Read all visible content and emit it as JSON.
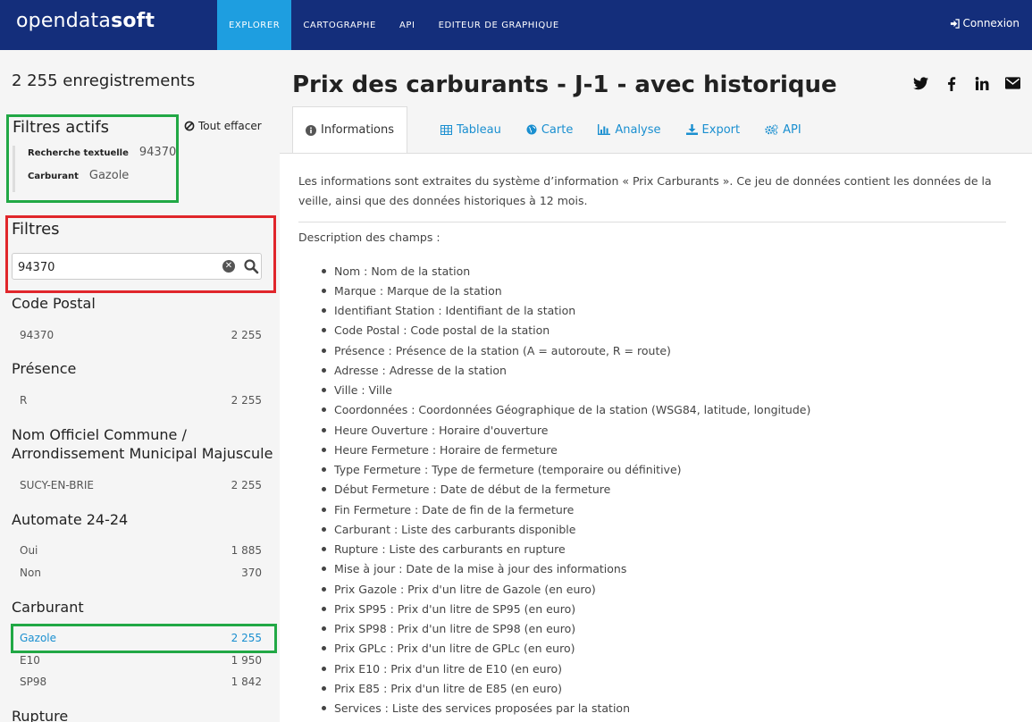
{
  "header": {
    "logo_light": "opendata",
    "logo_bold": "soft",
    "nav": [
      "EXPLORER",
      "CARTOGRAPHE",
      "API",
      "EDITEUR DE GRAPHIQUE"
    ],
    "login": "Connexion"
  },
  "sidebar": {
    "record_count": "2 255 enregistrements",
    "active_filters_title": "Filtres actifs",
    "clear_all": "Tout effacer",
    "active_filters": [
      {
        "label": "Recherche textuelle",
        "value": "94370"
      },
      {
        "label": "Carburant",
        "value": "Gazole"
      }
    ],
    "filters_title": "Filtres",
    "search_value": "94370",
    "facets": {
      "code_postal": {
        "title": "Code Postal",
        "items": [
          {
            "label": "94370",
            "count": "2 255"
          }
        ]
      },
      "presence": {
        "title": "Présence",
        "items": [
          {
            "label": "R",
            "count": "2 255"
          }
        ]
      },
      "commune": {
        "title_line1": "Nom Officiel Commune /",
        "title_line2": "Arrondissement Municipal Majuscule",
        "items": [
          {
            "label": "SUCY-EN-BRIE",
            "count": "2 255"
          }
        ]
      },
      "automate": {
        "title": "Automate 24-24",
        "items": [
          {
            "label": "Oui",
            "count": "1 885"
          },
          {
            "label": "Non",
            "count": "370"
          }
        ]
      },
      "carburant": {
        "title": "Carburant",
        "items": [
          {
            "label": "Gazole",
            "count": "2 255"
          },
          {
            "label": "E10",
            "count": "1 950"
          },
          {
            "label": "SP98",
            "count": "1 842"
          }
        ]
      },
      "rupture": {
        "title": "Rupture"
      }
    }
  },
  "main": {
    "title": "Prix des carburants - J-1 - avec historique",
    "tabs": [
      "Informations",
      "Tableau",
      "Carte",
      "Analyse",
      "Export",
      "API"
    ],
    "intro": "Les informations sont extraites du système d’information « Prix Carburants ». Ce jeu de données contient les données de la veille, ainsi que des données historiques à 12 mois.",
    "description_label": "Description des champs :",
    "fields": [
      "Nom : Nom de la station",
      "Marque : Marque de la station",
      "Identifiant Station : Identifiant de la station",
      "Code Postal : Code postal de la station",
      "Présence : Présence de la station (A = autoroute, R = route)",
      "Adresse : Adresse de la station",
      "Ville : Ville",
      "Coordonnées : Coordonnées Géographique de la station (WSG84, latitude, longitude)",
      "Heure Ouverture : Horaire d'ouverture",
      "Heure Fermeture : Horaire de fermeture",
      "Type Fermeture : Type de fermeture (temporaire ou définitive)",
      "Début Fermeture : Date de début de la fermeture",
      "Fin Fermeture : Date de fin de la fermeture",
      "Carburant : Liste des carburants disponible",
      "Rupture : Liste des carburants en rupture",
      "Mise à jour : Date de la mise à jour des informations",
      "Prix Gazole : Prix d'un litre de Gazole (en euro)",
      "Prix SP95 : Prix d'un litre de SP95 (en euro)",
      "Prix SP98 : Prix d'un litre de SP98 (en euro)",
      "Prix GPLc : Prix d'un litre de GPLc (en euro)",
      "Prix E10 : Prix d'un litre de E10 (en euro)",
      "Prix E85 : Prix d'un litre de E85 (en euro)",
      "Services : Liste des services proposées par la station"
    ]
  },
  "colors": {
    "navbar": "#142e7b",
    "active_nav": "#1e9ee0",
    "link": "#1a8fd0",
    "highlight_green": "#21a845",
    "highlight_red": "#e0262b"
  }
}
